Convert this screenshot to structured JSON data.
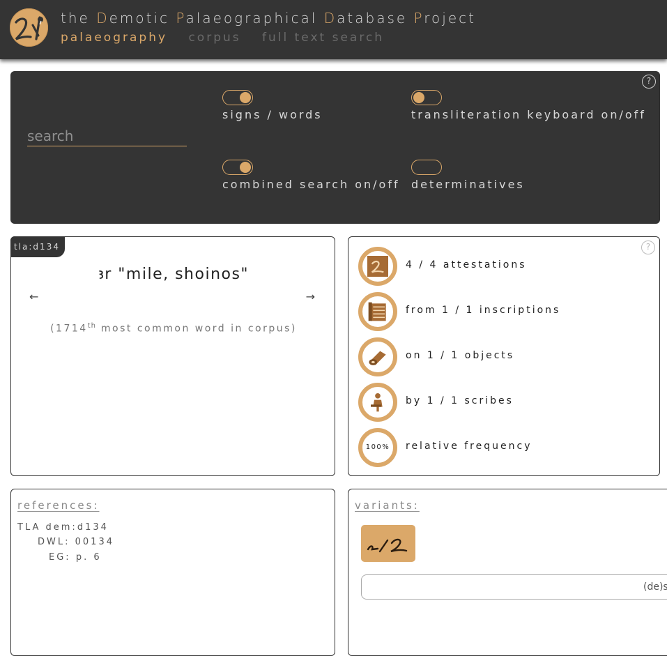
{
  "header": {
    "title_parts": [
      {
        "text": "the ",
        "accent": false
      },
      {
        "text": "D",
        "accent": true
      },
      {
        "text": "emotic ",
        "accent": false
      },
      {
        "text": "P",
        "accent": true
      },
      {
        "text": "alaeographical ",
        "accent": false
      },
      {
        "text": "D",
        "accent": true
      },
      {
        "text": "atabase ",
        "accent": false
      },
      {
        "text": "P",
        "accent": true
      },
      {
        "text": "roject",
        "accent": false
      }
    ],
    "nav": [
      "palaeography",
      "corpus",
      "full text search"
    ],
    "active_nav": "palaeography"
  },
  "search_panel": {
    "search_placeholder": "search",
    "search_value": "",
    "help_label": "?",
    "toggles": [
      {
        "id": "signs-words",
        "label": "signs / words",
        "on": true
      },
      {
        "id": "translit-keyboard",
        "label": "transliteration keyboard on/off",
        "on": false
      },
      {
        "id": "combined-search",
        "label": "combined search on/off",
        "on": true
      },
      {
        "id": "determinatives",
        "label": "determinatives",
        "on": null
      }
    ]
  },
  "word_card": {
    "tla_id": "tla:d134",
    "lemma": "ꜣr \"mile, shoinos\"",
    "prev_arrow": "←",
    "next_arrow": "→",
    "rank_prefix": "(1714",
    "rank_suffix_sup": "th",
    "rank_rest": " most common word in corpus)"
  },
  "stats": {
    "help_label": "?",
    "rows": [
      {
        "icon": "sign-image-icon",
        "text": "4 / 4 attestations"
      },
      {
        "icon": "inscriptions-icon",
        "text": "from 1 / 1 inscriptions"
      },
      {
        "icon": "papyrus-scroll-icon",
        "text": "on 1 / 1 objects"
      },
      {
        "icon": "scribe-icon",
        "text": "by 1 / 1 scribes"
      },
      {
        "icon": "frequency-icon",
        "value": "100%",
        "text": "relative frequency"
      }
    ]
  },
  "references": {
    "title": "references:",
    "rows": [
      {
        "key": "TLA dem:",
        "value": "d134"
      },
      {
        "key": "DWL:",
        "value": "00134"
      },
      {
        "key": "EG:",
        "value": "p. 6"
      }
    ]
  },
  "variants": {
    "title": "variants:",
    "deselect_label": "(de)se"
  },
  "colors": {
    "accent": "#dba869",
    "dark": "#343434"
  }
}
